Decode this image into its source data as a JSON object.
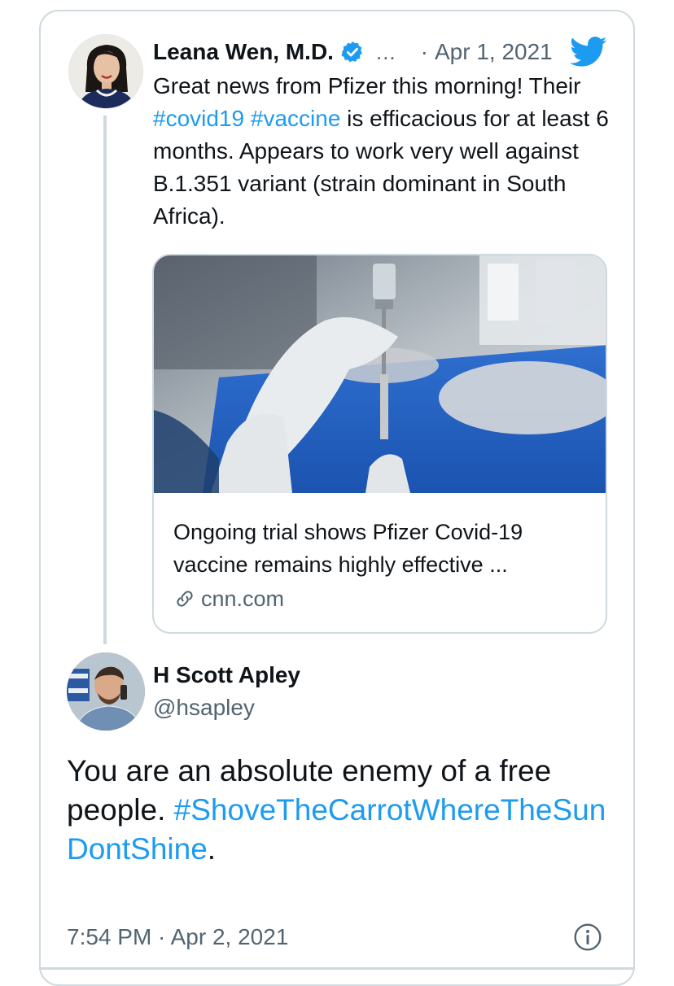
{
  "quoted_tweet": {
    "author_name": "Leana Wen, M.D.",
    "more_label": "...",
    "separator": "·",
    "date": "Apr 1, 2021",
    "text_parts": {
      "p1": "Great news from Pfizer this morning! Their ",
      "tag1": "#covid19",
      "space": " ",
      "tag2": "#vaccine",
      "p2": " is efficacious for at least 6 months. Appears to work very well against B.1.351 variant (strain dominant in South Africa)."
    },
    "link_card": {
      "title": "Ongoing trial shows Pfizer Covid-19 vaccine remains highly effective ...",
      "domain": "cnn.com"
    }
  },
  "reply_tweet": {
    "author_name": "H Scott Apley",
    "handle": "@hsapley",
    "text": "You are an absolute enemy of a free people. ",
    "hashtag": "#ShoveTheCarrotWhereTheSunDontShine",
    "trailing": ".",
    "timestamp": "7:54 PM · Apr 2, 2021"
  },
  "colors": {
    "link_blue": "#1d9bf0",
    "muted_gray": "#536471",
    "border_gray": "#cfd9de"
  },
  "icons": [
    "verified-badge-icon",
    "more-icon",
    "twitter-bird-icon",
    "link-icon",
    "info-icon"
  ]
}
